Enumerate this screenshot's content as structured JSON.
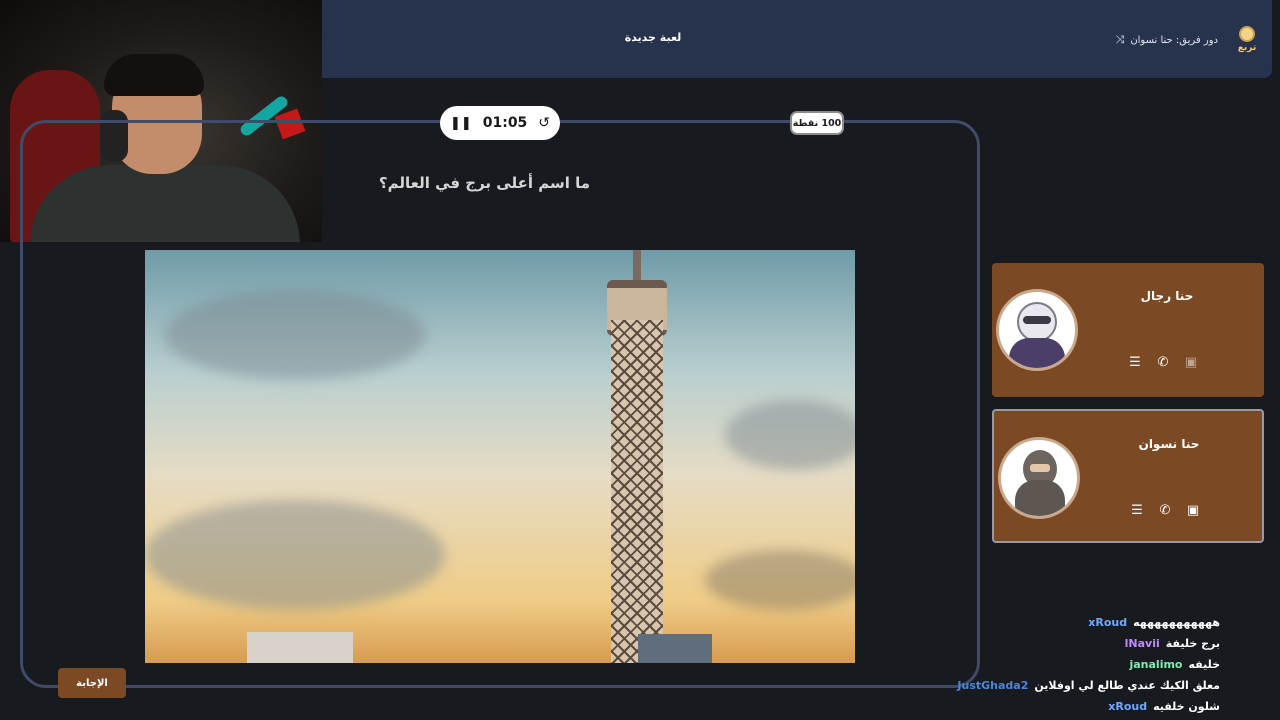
{
  "header": {
    "logo_text": "تربع",
    "turn_text": "دور فريق: حنا نسوان",
    "new_game_label": "لعبة جديدة"
  },
  "game": {
    "timer": "01:05",
    "points_label": "100 نقطة",
    "question": "ما اسم أعلى برج في العالم؟",
    "answer_button": "الإجابة"
  },
  "teams": [
    {
      "name": "حنا رجال"
    },
    {
      "name": "حنا نسوان"
    }
  ],
  "chat": [
    {
      "user": "xRoud",
      "color": "#6fa8ff",
      "message": "هههههههههههه"
    },
    {
      "user": "lNavii",
      "color": "#c38bff",
      "message": "برج خليفة"
    },
    {
      "user": "janalimo",
      "color": "#7df0b0",
      "message": "خليفه"
    },
    {
      "user": "JustGhada2",
      "color": "#4f86d9",
      "message": "معلق الكيك عندي طالع لي اوفلاين"
    },
    {
      "user": "xRoud",
      "color": "#6fa8ff",
      "message": "شلون خلفيه"
    }
  ]
}
